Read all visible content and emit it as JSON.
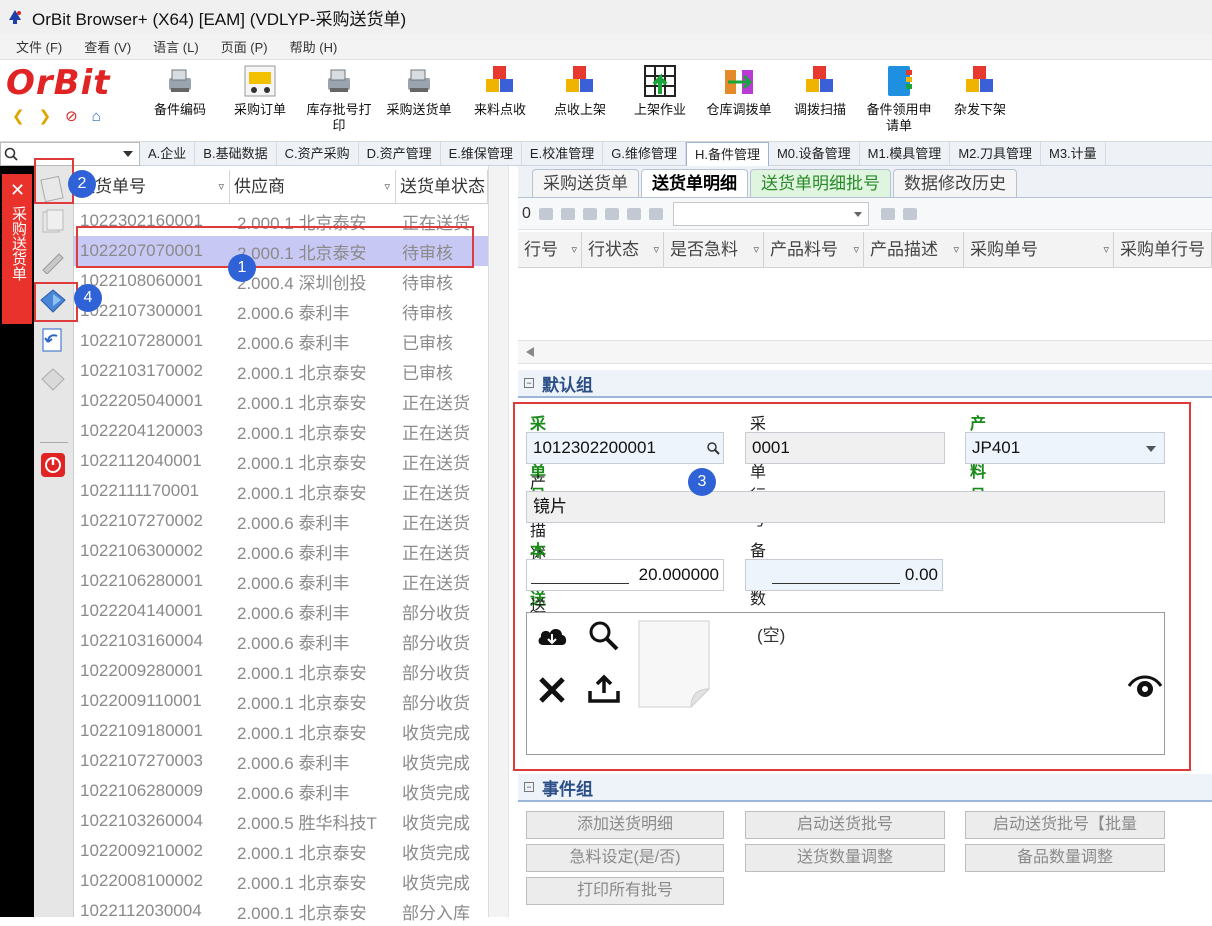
{
  "window": {
    "title": "OrBit Browser+ (X64) [EAM] (VDLYP-采购送货单)"
  },
  "menu": [
    "文件 (F)",
    "查看 (V)",
    "语言 (L)",
    "页面 (P)",
    "帮助 (H)"
  ],
  "logo": "OrBit",
  "toolbar": [
    {
      "label": "备件编码",
      "icon": "scanner-icon"
    },
    {
      "label": "采购订单",
      "icon": "cart-icon"
    },
    {
      "label": "库存批号打印",
      "icon": "scanner-icon"
    },
    {
      "label": "采购送货单",
      "icon": "scanner-icon"
    },
    {
      "label": "来料点收",
      "icon": "cubes-icon"
    },
    {
      "label": "点收上架",
      "icon": "cubes-icon"
    },
    {
      "label": "上架作业",
      "icon": "grid-arrow-icon"
    },
    {
      "label": "仓库调拨单",
      "icon": "transfer-icon"
    },
    {
      "label": "调拨扫描",
      "icon": "cubes-icon"
    },
    {
      "label": "备件领用申请单",
      "icon": "binder-icon"
    },
    {
      "label": "杂发下架",
      "icon": "cubes-icon"
    }
  ],
  "module_tabs": [
    "A.企业",
    "B.基础数据",
    "C.资产采购",
    "D.资产管理",
    "E.维保管理",
    "E.校准管理",
    "G.维修管理",
    "H.备件管理",
    "M0.设备管理",
    "M1.模具管理",
    "M2.刀具管理",
    "M3.计量"
  ],
  "active_module": "H.备件管理",
  "side_tab": "采购送货单",
  "list": {
    "columns": [
      "送货单号",
      "供应商",
      "送货单状态"
    ],
    "rows": [
      [
        "1022302160001",
        "2.000.1 北京泰安",
        "正在送货"
      ],
      [
        "1022207070001",
        "2.000.1 北京泰安",
        "待审核"
      ],
      [
        "1022108060001",
        "2.000.4 深圳创投",
        "待审核"
      ],
      [
        "1022107300001",
        "2.000.6 泰利丰",
        "待审核"
      ],
      [
        "1022107280001",
        "2.000.6 泰利丰",
        "已审核"
      ],
      [
        "1022103170002",
        "2.000.1 北京泰安",
        "已审核"
      ],
      [
        "1022205040001",
        "2.000.1 北京泰安",
        "正在送货"
      ],
      [
        "1022204120003",
        "2.000.1 北京泰安",
        "正在送货"
      ],
      [
        "1022112040001",
        "2.000.1 北京泰安",
        "正在送货"
      ],
      [
        "1022111170001",
        "2.000.1 北京泰安",
        "正在送货"
      ],
      [
        "1022107270002",
        "2.000.6 泰利丰",
        "正在送货"
      ],
      [
        "1022106300002",
        "2.000.6 泰利丰",
        "正在送货"
      ],
      [
        "1022106280001",
        "2.000.6 泰利丰",
        "正在送货"
      ],
      [
        "1022204140001",
        "2.000.6 泰利丰",
        "部分收货"
      ],
      [
        "1022103160004",
        "2.000.6 泰利丰",
        "部分收货"
      ],
      [
        "1022009280001",
        "2.000.1 北京泰安",
        "部分收货"
      ],
      [
        "1022009110001",
        "2.000.1 北京泰安",
        "部分收货"
      ],
      [
        "1022109180001",
        "2.000.1 北京泰安",
        "收货完成"
      ],
      [
        "1022107270003",
        "2.000.6 泰利丰",
        "收货完成"
      ],
      [
        "1022106280009",
        "2.000.6 泰利丰",
        "收货完成"
      ],
      [
        "1022103260004",
        "2.000.5 胜华科技T",
        "收货完成"
      ],
      [
        "1022009210002",
        "2.000.1 北京泰安",
        "收货完成"
      ],
      [
        "1022008100002",
        "2.000.1 北京泰安",
        "收货完成"
      ],
      [
        "1022112030004",
        "2.000.1 北京泰安",
        "部分入库"
      ]
    ]
  },
  "detail_tabs": [
    "采购送货单",
    "送货单明细",
    "送货单明细批号",
    "数据修改历史"
  ],
  "detail_toolbar": {
    "count": "0"
  },
  "detail_columns": [
    "行号",
    "行状态",
    "是否急料",
    "产品料号",
    "产品描述",
    "采购单号",
    "采购单行号"
  ],
  "default_group": {
    "title": "默认组",
    "po_no_label": "采购单号",
    "po_no": "1012302200001",
    "po_line_label": "采购单行号",
    "po_line": "0001",
    "part_no_label": "产品料号",
    "part_no": "JP401",
    "desc_label": "产品描述",
    "desc": "镜片",
    "qty_label": "本次送货数量",
    "qty": "20.000000",
    "spare_label": "备品数量",
    "spare": "0.00",
    "file_label": "送货文件",
    "file_empty": "(空)"
  },
  "event_group": {
    "title": "事件组",
    "buttons": [
      "添加送货明细",
      "启动送货批号",
      "启动送货批号【批量",
      "急料设定(是/否)",
      "送货数量调整",
      "备品数量调整",
      "打印所有批号"
    ]
  },
  "callouts": [
    "1",
    "2",
    "3",
    "4"
  ],
  "colors": {
    "highlight_red": "#e03b3b",
    "callout_blue": "#2f62d6",
    "selected_row": "#c8c8f5",
    "required_green": "#1a8a1a"
  }
}
